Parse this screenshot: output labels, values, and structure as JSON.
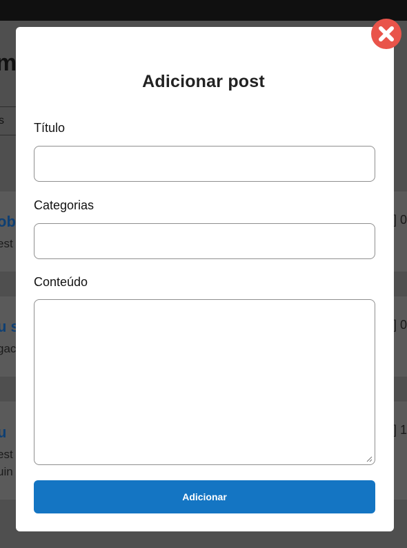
{
  "background": {
    "title_fragment": "m",
    "tab_fragment": "s",
    "cards": [
      {
        "title_fragment": "ob",
        "text_fragment": "est",
        "side_fragment": "] 0"
      },
      {
        "title_fragment": "u s",
        "text_fragment": "gac",
        "side_fragment": "] 0"
      },
      {
        "title_fragment": "u",
        "text_fragment": "est",
        "text2_fragment": "uin",
        "side_fragment": "] 1"
      }
    ]
  },
  "modal": {
    "title": "Adicionar post",
    "fields": {
      "title_label": "Título",
      "title_value": "",
      "categories_label": "Categorias",
      "categories_value": "",
      "content_label": "Conteúdo",
      "content_value": ""
    },
    "submit_label": "Adicionar",
    "close_icon": "close-x-icon"
  },
  "colors": {
    "accent": "#1475c3",
    "close": "#e9544a",
    "overlay": "#4f4f4f"
  }
}
